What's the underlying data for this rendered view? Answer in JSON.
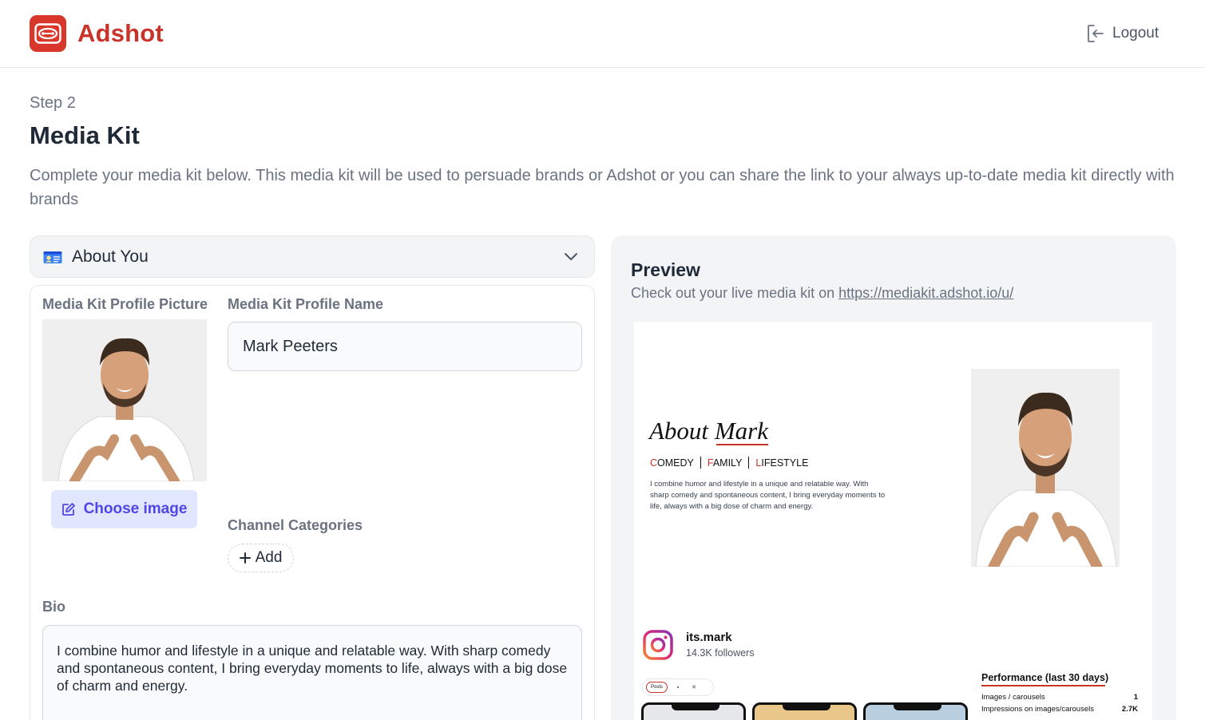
{
  "app": {
    "name": "Adshot",
    "brand_color": "#c8342a",
    "logo_icon": "tape-icon"
  },
  "header": {
    "logout_label": "Logout",
    "logout_icon": "logout-icon"
  },
  "page": {
    "step": "Step 2",
    "title": "Media Kit",
    "description": "Complete your media kit below. This media kit will be used to persuade brands or Adshot or you can share the link to your always up-to-date media kit directly with brands"
  },
  "section": {
    "title": "About You",
    "icon": "id-card-icon",
    "expanded": true
  },
  "form": {
    "picture_label": "Media Kit Profile Picture",
    "choose_image_label": "Choose image",
    "name_label": "Media Kit Profile Name",
    "name_value": "Mark Peeters",
    "categories_label": "Channel Categories",
    "add_label": "Add",
    "bio_label": "Bio",
    "bio_value": "I combine humor and lifestyle in a unique and relatable way. With sharp comedy and spontaneous content, I bring everyday moments to life, always with a big dose of charm and energy."
  },
  "preview": {
    "title": "Preview",
    "subtitle": "Check out your live media kit on",
    "link": "https://mediakit.adshot.io/u/",
    "kit": {
      "about_prefix": "About ",
      "about_name": "Mark",
      "categories": [
        {
          "first": "C",
          "rest": "OMEDY"
        },
        {
          "first": "F",
          "rest": "AMILY"
        },
        {
          "first": "L",
          "rest": "IFESTYLE"
        }
      ],
      "bio": "I combine humor and lifestyle in a unique and relatable way. With sharp comedy and spontaneous content, I bring everyday moments to life, always with a big dose of charm and energy.",
      "instagram": {
        "handle": "its.mark",
        "followers": "14.3K followers"
      },
      "tabs": {
        "posts": "Posts"
      },
      "performance": {
        "title": "Performance (last 30 days)",
        "rows": [
          {
            "label": "Images / carousels",
            "value": "1"
          },
          {
            "label": "Impressions on images/carousels",
            "value": "2.7K"
          }
        ]
      }
    }
  }
}
